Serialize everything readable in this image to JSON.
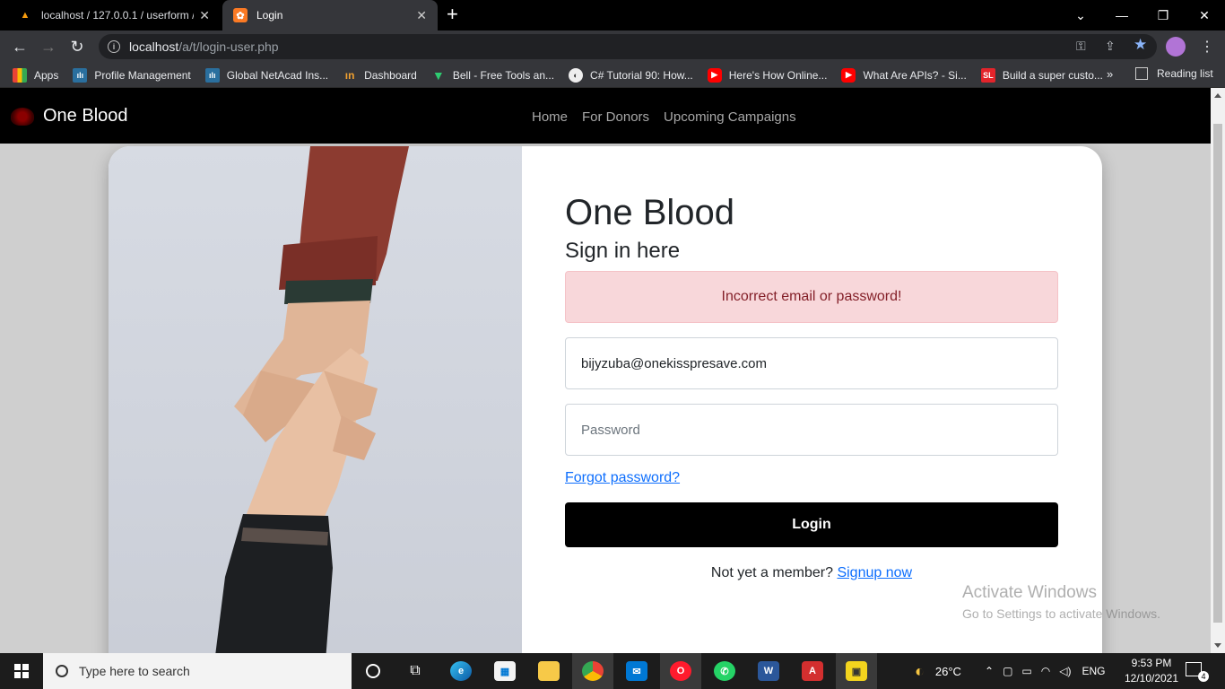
{
  "browser": {
    "tabs": [
      {
        "title": "localhost / 127.0.0.1 / userform /",
        "active": false
      },
      {
        "title": "Login",
        "active": true
      }
    ],
    "url_host": "localhost",
    "url_path": "/a/t/login-user.php",
    "bookmarks": [
      {
        "label": "Apps",
        "icon": "apps-grid-icon"
      },
      {
        "label": "Profile Management",
        "icon": "cisco-icon"
      },
      {
        "label": "Global NetAcad Ins...",
        "icon": "cisco-icon"
      },
      {
        "label": "Dashboard",
        "icon": "dashboard-icon"
      },
      {
        "label": "Bell - Free Tools an...",
        "icon": "bell-icon"
      },
      {
        "label": "C# Tutorial 90: How...",
        "icon": "globe-icon"
      },
      {
        "label": "Here's How Online...",
        "icon": "youtube-icon"
      },
      {
        "label": "What Are APIs? - Si...",
        "icon": "youtube-icon"
      },
      {
        "label": "Build a super custo...",
        "icon": "sl-icon"
      }
    ],
    "bookmarks_more": "»",
    "reading_list": "Reading list"
  },
  "site": {
    "brand": "One Blood",
    "nav": [
      "Home",
      "For Donors",
      "Upcoming Campaigns"
    ]
  },
  "login": {
    "heading": "One Blood",
    "subheading": "Sign in here",
    "alert": "Incorrect email or password!",
    "email_value": "bijyzuba@onekisspresave.com",
    "password_placeholder": "Password",
    "forgot": "Forgot password?",
    "button": "Login",
    "member_text": "Not yet a member?",
    "signup": "Signup now"
  },
  "watermark": {
    "line1": "Activate Windows",
    "line2": "Go to Settings to activate Windows."
  },
  "taskbar": {
    "search_placeholder": "Type here to search",
    "weather": "26°C",
    "language": "ENG",
    "time": "9:53 PM",
    "date": "12/10/2021",
    "notifications": "4"
  },
  "colors": {
    "alert_bg": "#f8d7da",
    "alert_text": "#842029",
    "link": "#0d6efd",
    "button_bg": "#000000"
  }
}
